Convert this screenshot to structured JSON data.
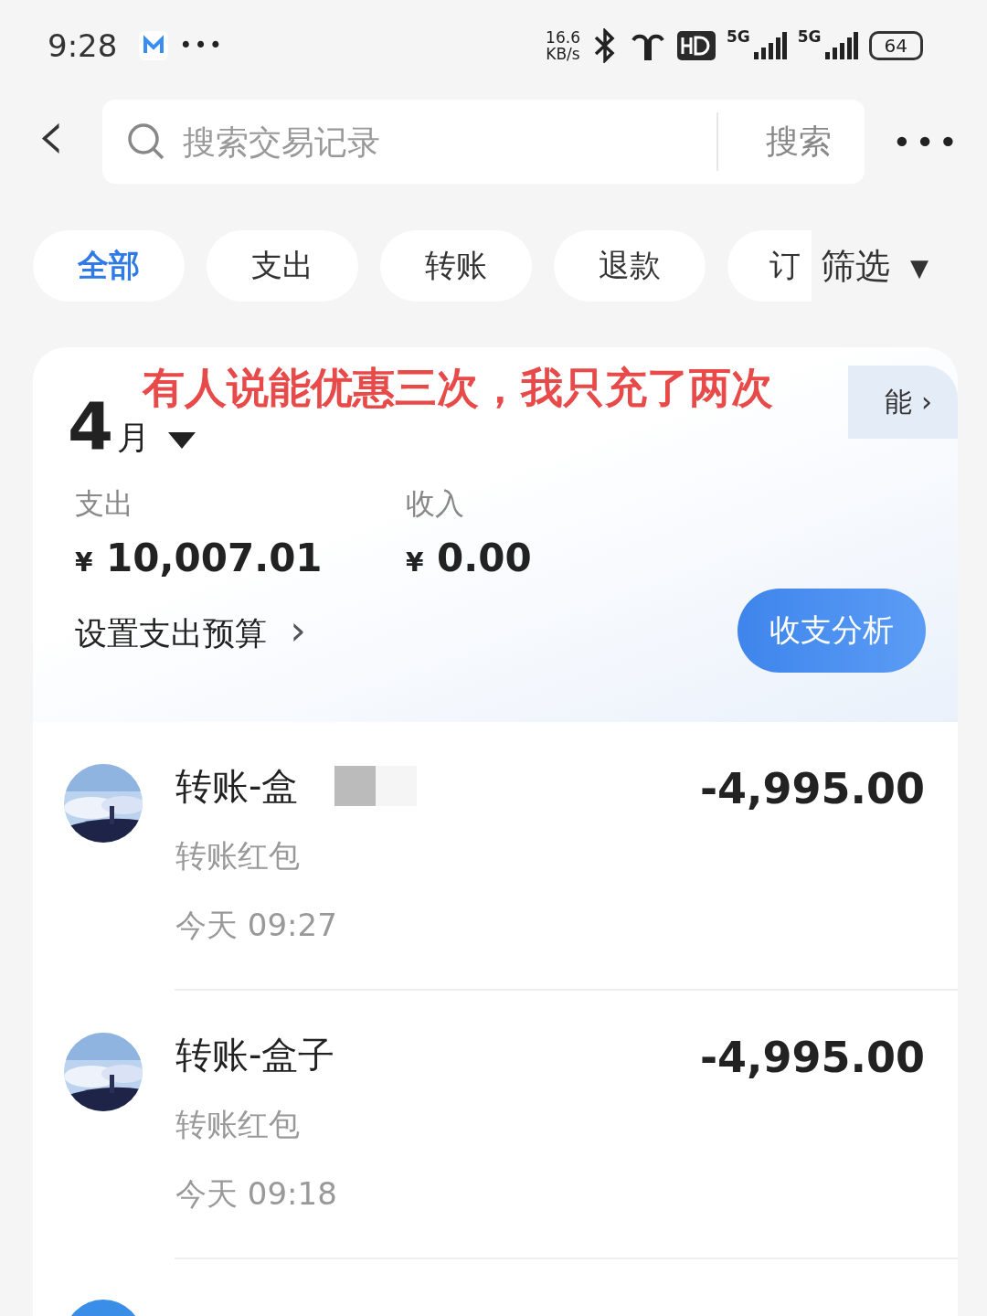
{
  "status_bar": {
    "time": "9:28",
    "more": "•••",
    "speed_value": "16.6",
    "speed_unit": "KB/s",
    "network_1": "5G",
    "network_2": "5G",
    "battery": "64"
  },
  "header": {
    "back": "‹",
    "search_placeholder": "搜索交易记录",
    "search_button": "搜索",
    "more": "•••"
  },
  "tabs": [
    {
      "label": "全部",
      "selected": true
    },
    {
      "label": "支出",
      "selected": false
    },
    {
      "label": "转账",
      "selected": false
    },
    {
      "label": "退款",
      "selected": false
    },
    {
      "label": "订",
      "selected": false
    }
  ],
  "filter": {
    "label": "筛选",
    "caret": "▼"
  },
  "overlay_caption": "有人说能优惠三次，我只充了两次",
  "summary": {
    "banner_text": "能",
    "banner_chevron": "›",
    "month": "4",
    "month_unit": "月",
    "expense_label": "支出",
    "expense_currency": "¥",
    "expense_value": "10,007.01",
    "income_label": "收入",
    "income_currency": "¥",
    "income_value": "0.00",
    "budget_link": "设置支出预算",
    "budget_chevron": "›",
    "analysis_button": "收支分析"
  },
  "transactions": [
    {
      "title": "转账-盒",
      "redacted": true,
      "amount": "-4,995.00",
      "category": "转账红包",
      "time": "今天 09:27"
    },
    {
      "title": "转账-盒子",
      "redacted": false,
      "amount": "-4,995.00",
      "category": "转账红包",
      "time": "今天 09:18"
    }
  ]
}
